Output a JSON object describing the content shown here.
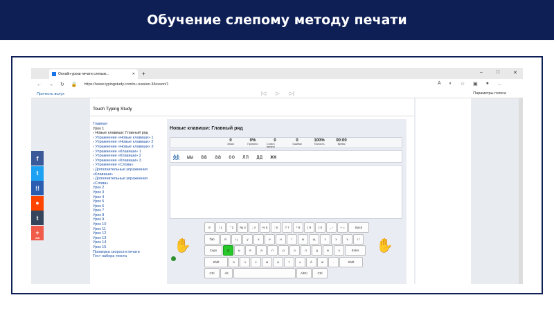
{
  "banner": {
    "title": "Обучение слепому методу печати"
  },
  "browser": {
    "tab_title": "Онлайн-уроки печати слепым...",
    "new_tab": "+",
    "url": "https://www.typingstudy.com/ru-russian-3/lesson/1",
    "read_aloud": "Прочесть вслух",
    "voice_params": "Параметры голоса",
    "win_min": "–",
    "win_max": "□",
    "win_close": "✕"
  },
  "site": {
    "brand": "Touch Typing Study",
    "nav": [
      {
        "label": "Главная",
        "cur": false
      },
      {
        "label": "Урок 1",
        "cur": true
      },
      {
        "label": "›  Новые клавиши: Главный ряд",
        "cur": true
      },
      {
        "label": "›  Упражнение «Новые клавиши» 1",
        "cur": false
      },
      {
        "label": "›  Упражнение «Новые клавиши» 2",
        "cur": false
      },
      {
        "label": "›  Упражнение «Новые клавиши» 3",
        "cur": false
      },
      {
        "label": "›  Упражнение «Клавиши» 1",
        "cur": false
      },
      {
        "label": "›  Упражнение «Клавиши» 2",
        "cur": false
      },
      {
        "label": "›  Упражнение «Клавиши» 3",
        "cur": false
      },
      {
        "label": "›  Упражнение «Слова»",
        "cur": false
      },
      {
        "label": "›  Дополнительные упражнения «Клавиши»",
        "cur": false
      },
      {
        "label": "›  Дополнительные упражнения «Слова»",
        "cur": false
      },
      {
        "label": "Урок 2",
        "cur": false
      },
      {
        "label": "Урок 3",
        "cur": false
      },
      {
        "label": "Урок 4",
        "cur": false
      },
      {
        "label": "Урок 5",
        "cur": false
      },
      {
        "label": "Урок 6",
        "cur": false
      },
      {
        "label": "Урок 7",
        "cur": false
      },
      {
        "label": "Урок 8",
        "cur": false
      },
      {
        "label": "Урок 9",
        "cur": false
      },
      {
        "label": "Урок 10",
        "cur": false
      },
      {
        "label": "Урок 11",
        "cur": false
      },
      {
        "label": "Урок 12",
        "cur": false
      },
      {
        "label": "Урок 13",
        "cur": false
      },
      {
        "label": "Урок 14",
        "cur": false
      },
      {
        "label": "Урок 15",
        "cur": false
      },
      {
        "label": "Проверка скорости печати",
        "cur": false
      },
      {
        "label": "Тест набора текста",
        "cur": false
      }
    ],
    "lesson_title": "Новые клавиши: Главный ряд",
    "stats": [
      {
        "value": "0",
        "label": "Знаки"
      },
      {
        "value": "0%",
        "label": "Прогресс"
      },
      {
        "value": "0",
        "label": "Слов в минуту"
      },
      {
        "value": "0",
        "label": "Ошибки"
      },
      {
        "value": "100%",
        "label": "Точность"
      },
      {
        "value": "00:00",
        "label": "Время"
      }
    ],
    "words": [
      "фф",
      "ыы",
      "вв",
      "аа",
      "оо",
      "лл",
      "дд",
      "жж"
    ],
    "keyboard": {
      "rows": [
        {
          "keys": [
            "ё",
            "! 1",
            "\" 2",
            "№ 3",
            "; 4",
            "% 5",
            ": 6",
            "? 7",
            "* 8",
            "( 9",
            ") 0",
            "_ -",
            "+ =",
            "Back"
          ]
        },
        {
          "keys": [
            "Tab",
            "й",
            "ц",
            "у",
            "к",
            "е",
            "н",
            "г",
            "ш",
            "щ",
            "з",
            "х",
            "ъ",
            "\\ /"
          ]
        },
        {
          "keys": [
            "Caps",
            "ф",
            "ы",
            "в",
            "а",
            "п",
            "р",
            "о",
            "л",
            "д",
            "ж",
            "э",
            "Enter"
          ]
        },
        {
          "keys": [
            "Shift",
            "я",
            "ч",
            "с",
            "м",
            "и",
            "т",
            "ь",
            "б",
            "ю",
            ".",
            "Shift"
          ]
        },
        {
          "keys": [
            "Ctrl",
            "Alt",
            "",
            "AltGr",
            "Ctrl"
          ]
        }
      ],
      "active_key": "ф"
    }
  },
  "social": [
    {
      "name": "facebook",
      "glyph": "f",
      "color": "#3b5998"
    },
    {
      "name": "twitter",
      "glyph": "t",
      "color": "#1da1f2"
    },
    {
      "name": "apps",
      "glyph": "⁞⁞",
      "color": "#2a5db0"
    },
    {
      "name": "reddit",
      "glyph": "●",
      "color": "#ff4500"
    },
    {
      "name": "tumblr",
      "glyph": "t",
      "color": "#35465c"
    },
    {
      "name": "share",
      "glyph": "+",
      "color": "#f15b4a",
      "count": "208"
    }
  ]
}
